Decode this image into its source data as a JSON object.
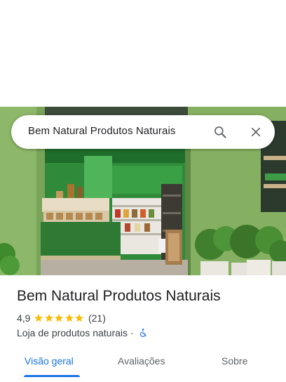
{
  "search": {
    "query": "Bem Natural Produtos Naturais"
  },
  "place": {
    "name": "Bem Natural Produtos Naturais",
    "rating": "4,9",
    "stars": 5,
    "review_count": "(21)",
    "category": "Loja de produtos naturais",
    "separator": "·"
  },
  "tabs": [
    {
      "label": "Visão geral",
      "active": true
    },
    {
      "label": "Avaliações",
      "active": false
    },
    {
      "label": "Sobre",
      "active": false
    }
  ],
  "colors": {
    "accent": "#1a73e8",
    "star": "#fbbc04",
    "storefront_green": "#2f8a3a",
    "wall_green": "#7fa65c"
  }
}
